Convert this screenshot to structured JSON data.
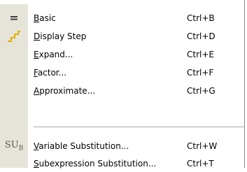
{
  "menu": {
    "items": [
      {
        "acc": "B",
        "rest": "asic",
        "shortcut": "Ctrl+B",
        "icon": "equals-icon"
      },
      {
        "acc": "D",
        "rest": "isplay Step",
        "shortcut": "Ctrl+D",
        "icon": "step-icon"
      },
      {
        "acc": "E",
        "rest": "xpand...",
        "shortcut": "Ctrl+E"
      },
      {
        "acc": "F",
        "rest": "actor...",
        "shortcut": "Ctrl+F"
      },
      {
        "acc": "A",
        "rest": "pproximate...",
        "shortcut": "Ctrl+G"
      },
      {
        "acc": "V",
        "rest": "ariable Substitution...",
        "shortcut": "Ctrl+W",
        "icon": "substitution-icon"
      },
      {
        "acc": "S",
        "rest": "ubexpression Substitution...",
        "shortcut": "Ctrl+T"
      }
    ],
    "icon_text": {
      "sub_main": "S",
      "sub_u": "U",
      "sub_script": "B",
      "equals": "="
    },
    "colors": {
      "gutter": "#e6e4d9",
      "step_icon": "#e0b000"
    }
  }
}
